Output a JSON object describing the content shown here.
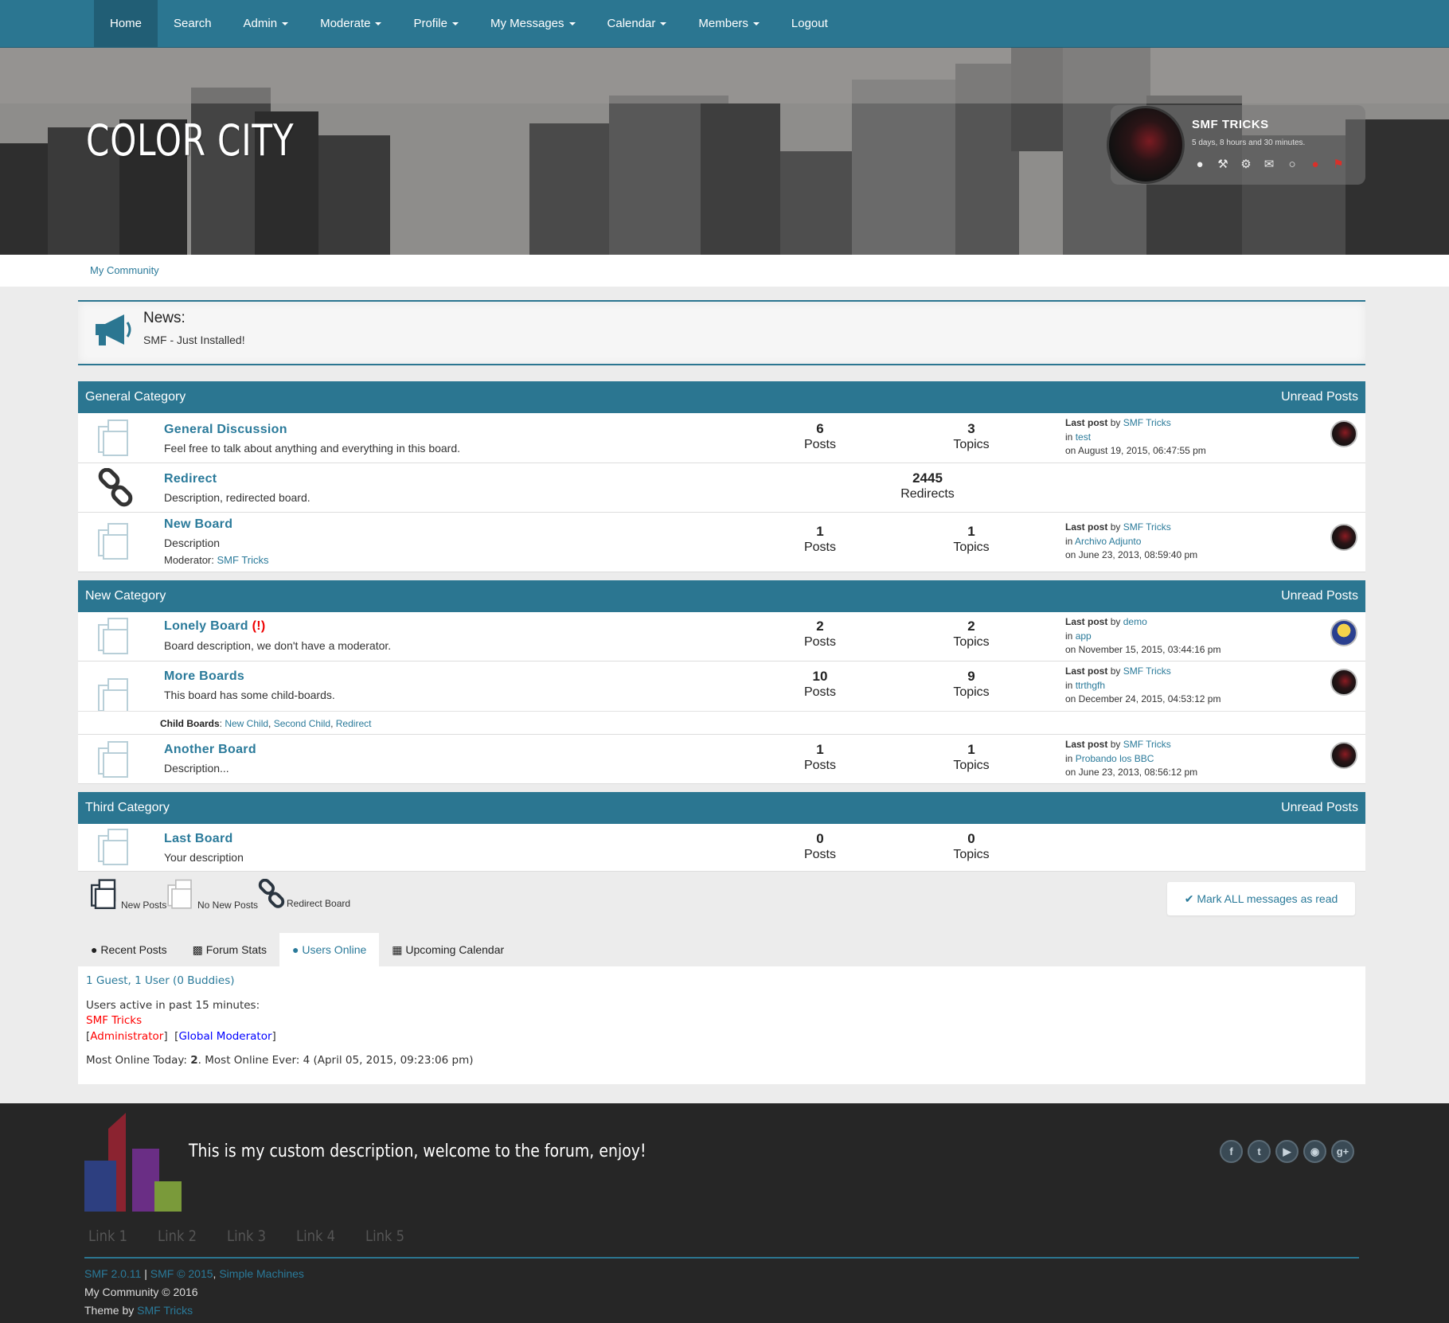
{
  "nav": {
    "items": [
      {
        "label": "Home",
        "dropdown": false,
        "active": true
      },
      {
        "label": "Search",
        "dropdown": false
      },
      {
        "label": "Admin",
        "dropdown": true
      },
      {
        "label": "Moderate",
        "dropdown": true
      },
      {
        "label": "Profile",
        "dropdown": true
      },
      {
        "label": "My Messages",
        "dropdown": true
      },
      {
        "label": "Calendar",
        "dropdown": true
      },
      {
        "label": "Members",
        "dropdown": true
      },
      {
        "label": "Logout",
        "dropdown": false
      }
    ]
  },
  "header": {
    "site_title": "COLOR CITY"
  },
  "user": {
    "name": "SMF TRICKS",
    "time_online": "5 days, 8 hours and 30 minutes.",
    "icons": [
      "profile-icon",
      "wrench-icon",
      "settings-icon",
      "messages-icon",
      "chat-icon",
      "members-icon",
      "flag-icon"
    ]
  },
  "breadcrumb": {
    "item": "My Community"
  },
  "news": {
    "title": "News:",
    "text": "SMF - Just Installed!",
    "icon": "megaphone-icon"
  },
  "categories": [
    {
      "name": "General Category",
      "unread": "Unread Posts",
      "boards": [
        {
          "name": "General Discussion",
          "desc": "Feel free to talk about anything and everything in this board.",
          "posts": "6",
          "posts_label": "Posts",
          "topics": "3",
          "topics_label": "Topics",
          "lastpost": {
            "label": "Last post",
            "by": "by",
            "user": "SMF Tricks",
            "in": "in",
            "topic": "test",
            "on": "on August 19, 2015, 06:47:55 pm"
          }
        },
        {
          "name": "Redirect",
          "desc": "Description, redirected board.",
          "redirects": "2445",
          "redirects_label": "Redirects"
        },
        {
          "name": "New Board",
          "desc": "Description",
          "moderator_label": "Moderator:",
          "moderator": "SMF Tricks",
          "posts": "1",
          "posts_label": "Posts",
          "topics": "1",
          "topics_label": "Topics",
          "lastpost": {
            "label": "Last post",
            "by": "by",
            "user": "SMF Tricks",
            "in": "in",
            "topic": "Archivo Adjunto",
            "on": "on June 23, 2013, 08:59:40 pm"
          }
        }
      ]
    },
    {
      "name": "New Category",
      "unread": "Unread Posts",
      "boards": [
        {
          "name": "Lonely Board",
          "flag": "(!)",
          "desc": "Board description, we don't have a moderator.",
          "posts": "2",
          "posts_label": "Posts",
          "topics": "2",
          "topics_label": "Topics",
          "lastpost": {
            "label": "Last post",
            "by": "by",
            "user": "demo",
            "in": "in",
            "topic": "app",
            "on": "on November 15, 2015, 03:44:16 pm"
          }
        },
        {
          "name": "More Boards",
          "desc": "This board has some child-boards.",
          "posts": "10",
          "posts_label": "Posts",
          "topics": "9",
          "topics_label": "Topics",
          "lastpost": {
            "label": "Last post",
            "by": "by",
            "user": "SMF Tricks",
            "in": "in",
            "topic": "ttrthgfh",
            "on": "on December 24, 2015, 04:53:12 pm"
          },
          "child_label": "Child Boards",
          "children": [
            "New Child",
            "Second Child",
            "Redirect"
          ]
        },
        {
          "name": "Another Board",
          "desc": "Description...",
          "posts": "1",
          "posts_label": "Posts",
          "topics": "1",
          "topics_label": "Topics",
          "lastpost": {
            "label": "Last post",
            "by": "by",
            "user": "SMF Tricks",
            "in": "in",
            "topic": "Probando los BBC",
            "on": "on June 23, 2013, 08:56:12 pm"
          }
        }
      ]
    },
    {
      "name": "Third Category",
      "unread": "Unread Posts",
      "boards": [
        {
          "name": "Last Board",
          "desc": "Your description",
          "posts": "0",
          "posts_label": "Posts",
          "topics": "0",
          "topics_label": "Topics"
        }
      ]
    }
  ],
  "legend": {
    "new_posts": "New Posts",
    "no_new_posts": "No New Posts",
    "redirect_board": "Redirect Board"
  },
  "mark_read": "Mark ALL messages as read",
  "tabs": [
    {
      "label": "Recent Posts",
      "icon": "comments-icon"
    },
    {
      "label": "Forum Stats",
      "icon": "bar-chart-icon"
    },
    {
      "label": "Users Online",
      "icon": "users-icon",
      "active": true
    },
    {
      "label": "Upcoming Calendar",
      "icon": "calendar-icon"
    }
  ],
  "online": {
    "summary": "1 Guest, 1 User (0 Buddies)",
    "active_label": "Users active in past 15 minutes:",
    "user": "SMF Tricks",
    "group1": "Administrator",
    "group2": "Global Moderator",
    "most_today_label": "Most Online Today: ",
    "most_today": "2",
    "most_ever": ". Most Online Ever: 4 (April 05, 2015, 09:23:06 pm)"
  },
  "colors": {
    "accent": "#2b7691",
    "admin": "#ff0000",
    "global_mod": "#0000ff",
    "footer_bg": "#262626"
  },
  "footer": {
    "description": "This is my custom description, welcome to the forum, enjoy!",
    "social": [
      "facebook-icon",
      "twitter-icon",
      "youtube-icon",
      "instagram-icon",
      "google-plus-icon"
    ],
    "links": [
      "Link 1",
      "Link 2",
      "Link 3",
      "Link 4",
      "Link 5"
    ],
    "smf_version": "SMF 2.0.11",
    "smf_copyright": "SMF © 2015",
    "simple_machines": "Simple Machines",
    "community": "My Community © 2016",
    "theme_by": "Theme by",
    "theme_author": "SMF Tricks"
  }
}
